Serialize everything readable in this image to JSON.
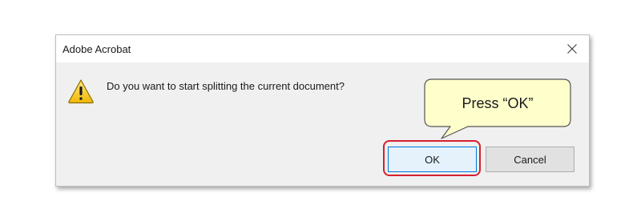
{
  "dialog": {
    "title": "Adobe Acrobat",
    "message": "Do you want to start splitting the current document?",
    "icon": "warning-icon",
    "buttons": {
      "ok_label": "OK",
      "cancel_label": "Cancel"
    }
  },
  "annotation": {
    "callout_text": "Press “OK”",
    "highlight_color": "#d6202f",
    "callout_fill": "#ffffcc"
  }
}
